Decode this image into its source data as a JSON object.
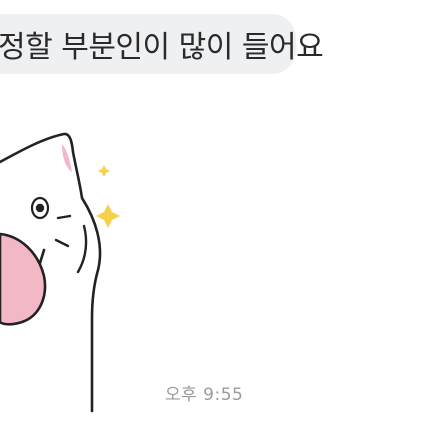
{
  "message": {
    "text": "정할 부분인이 많이 들어요"
  },
  "sticker": {
    "icon": "cat-sticker-icon",
    "accent_color": "#f2b8c6",
    "sparkle_color": "#f7cf4a"
  },
  "timestamp": {
    "label": "오후 9:55"
  }
}
